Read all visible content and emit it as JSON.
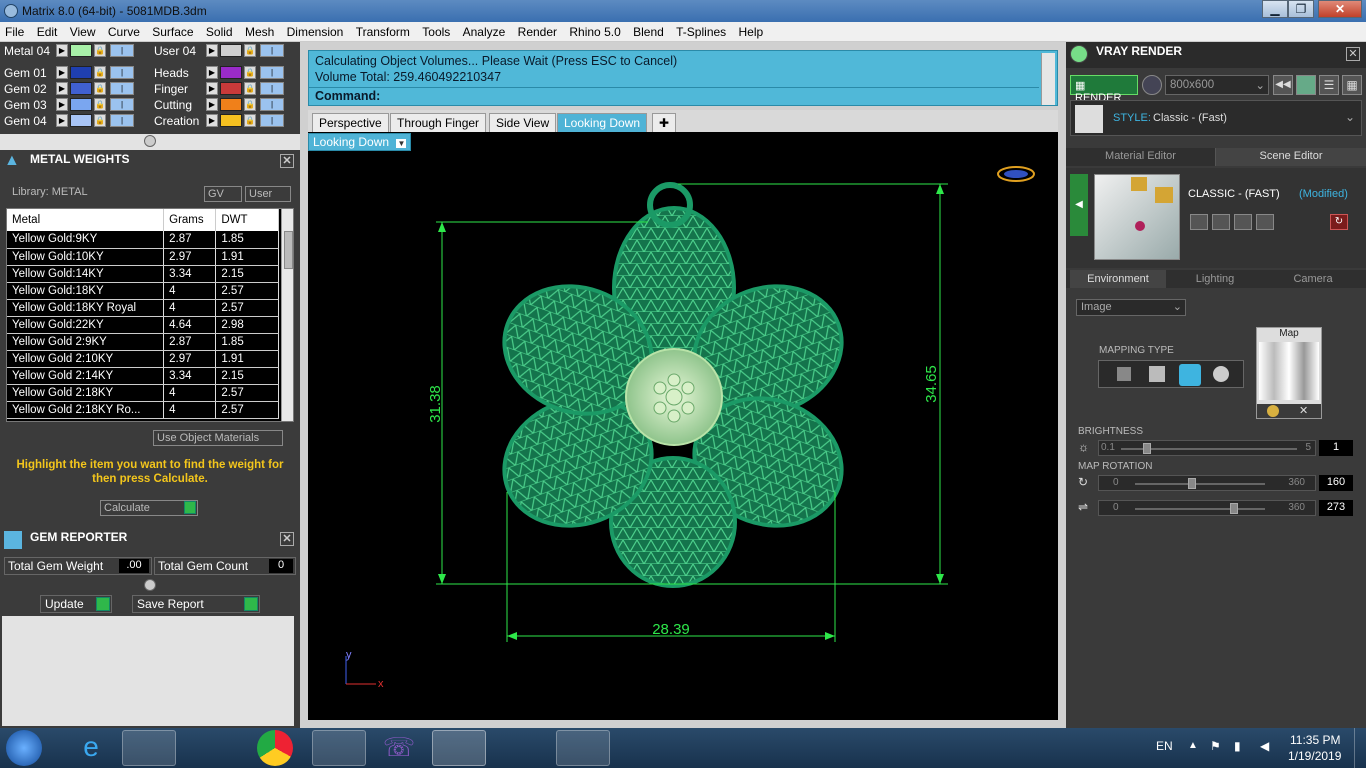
{
  "window": {
    "title": "Matrix 8.0 (64-bit) - 5081MDB.3dm"
  },
  "menu": [
    "File",
    "Edit",
    "View",
    "Curve",
    "Surface",
    "Solid",
    "Mesh",
    "Dimension",
    "Transform",
    "Tools",
    "Analyze",
    "Render",
    "Rhino 5.0",
    "Blend",
    "T-Splines",
    "Help"
  ],
  "layers_left": [
    {
      "name": "Metal 04",
      "color": "#a8f0a8"
    },
    {
      "name": "Gem 01",
      "color": "#1f3fb0"
    },
    {
      "name": "Gem 02",
      "color": "#4060d0"
    },
    {
      "name": "Gem 03",
      "color": "#7aa6f0"
    },
    {
      "name": "Gem 04",
      "color": "#a8c4f5"
    }
  ],
  "layers_right": [
    {
      "name": "User 04",
      "color": "#cfcfcf"
    },
    {
      "name": "Heads",
      "color": "#9a2bc9"
    },
    {
      "name": "Finger",
      "color": "#c83a3a"
    },
    {
      "name": "Cutting",
      "color": "#f0801a"
    },
    {
      "name": "Creation",
      "color": "#f5c020"
    }
  ],
  "metal_weights": {
    "title": "METAL WEIGHTS",
    "library_label": "Library: METAL",
    "gv_label": "GV",
    "user_label": "User",
    "columns": [
      "Metal",
      "Grams",
      "DWT"
    ],
    "rows": [
      [
        "Yellow Gold:9KY",
        "2.87",
        "1.85"
      ],
      [
        "Yellow Gold:10KY",
        "2.97",
        "1.91"
      ],
      [
        "Yellow Gold:14KY",
        "3.34",
        "2.15"
      ],
      [
        "Yellow Gold:18KY",
        "4",
        "2.57"
      ],
      [
        "Yellow Gold:18KY Royal",
        "4",
        "2.57"
      ],
      [
        "Yellow Gold:22KY",
        "4.64",
        "2.98"
      ],
      [
        "Yellow Gold 2:9KY",
        "2.87",
        "1.85"
      ],
      [
        "Yellow Gold 2:10KY",
        "2.97",
        "1.91"
      ],
      [
        "Yellow Gold 2:14KY",
        "3.34",
        "2.15"
      ],
      [
        "Yellow Gold 2:18KY",
        "4",
        "2.57"
      ],
      [
        "Yellow Gold 2:18KY Ro...",
        "4",
        "2.57"
      ]
    ],
    "use_object_materials": "Use Object Materials",
    "hint": "Highlight the item you want to find the weight for then press Calculate.",
    "calculate": "Calculate"
  },
  "gem_reporter": {
    "title": "GEM REPORTER",
    "total_weight_label": "Total Gem Weight",
    "total_weight_value": ".00",
    "total_count_label": "Total Gem Count",
    "total_count_value": "0",
    "update": "Update",
    "save_report": "Save Report"
  },
  "command": {
    "line1": "Calculating Object Volumes... Please Wait (Press ESC to Cancel)",
    "line2": "Volume Total: 259.460492210347",
    "prompt": "Command:"
  },
  "view_tabs": [
    "Perspective",
    "Through Finger",
    "Side View",
    "Looking Down"
  ],
  "active_view": "Looking Down",
  "dimensions": {
    "left": "31.38",
    "right": "34.65",
    "bottom": "28.39"
  },
  "axis": {
    "y": "y",
    "x": "x"
  },
  "vray": {
    "title": "VRAY RENDER",
    "render_label": "RENDER",
    "resolution": "800x600",
    "style_label": "STYLE:",
    "style_value": "Classic - (Fast)",
    "tabs": [
      "Material Editor",
      "Scene Editor"
    ],
    "preset_name": "CLASSIC - (FAST)",
    "preset_modified": "(Modified)",
    "env_tabs": [
      "Environment",
      "Lighting",
      "Camera"
    ],
    "env_select": "Image",
    "mapping_type": "MAPPING TYPE",
    "map_label": "Map",
    "brightness_label": "BRIGHTNESS",
    "brightness": {
      "min": "0.1",
      "max": "5",
      "value": "1",
      "fraction": 0.15
    },
    "map_rotation_label": "MAP ROTATION",
    "rot1": {
      "min": "0",
      "max": "360",
      "value": "160",
      "fraction": 0.44
    },
    "rot2": {
      "min": "0",
      "max": "360",
      "value": "273",
      "fraction": 0.76
    }
  },
  "taskbar": {
    "lang": "EN",
    "time": "11:35 PM",
    "date": "1/19/2019"
  }
}
